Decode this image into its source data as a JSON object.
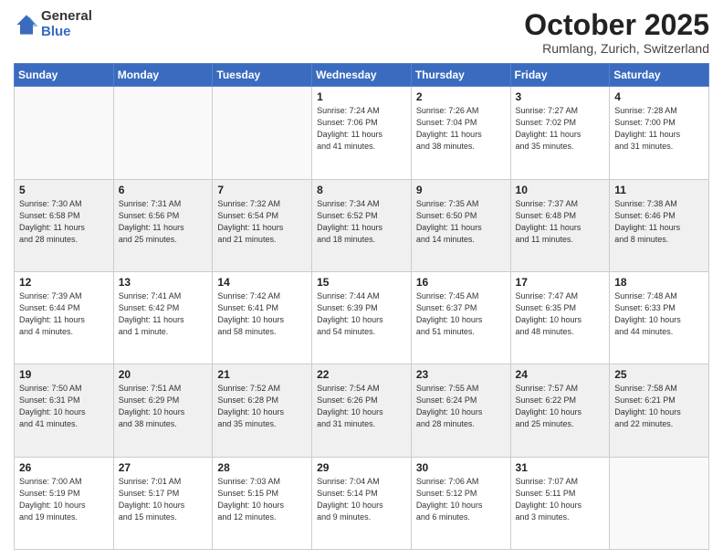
{
  "logo": {
    "general": "General",
    "blue": "Blue"
  },
  "header": {
    "month": "October 2025",
    "location": "Rumlang, Zurich, Switzerland"
  },
  "days_of_week": [
    "Sunday",
    "Monday",
    "Tuesday",
    "Wednesday",
    "Thursday",
    "Friday",
    "Saturday"
  ],
  "weeks": [
    [
      {
        "day": "",
        "info": ""
      },
      {
        "day": "",
        "info": ""
      },
      {
        "day": "",
        "info": ""
      },
      {
        "day": "1",
        "info": "Sunrise: 7:24 AM\nSunset: 7:06 PM\nDaylight: 11 hours\nand 41 minutes."
      },
      {
        "day": "2",
        "info": "Sunrise: 7:26 AM\nSunset: 7:04 PM\nDaylight: 11 hours\nand 38 minutes."
      },
      {
        "day": "3",
        "info": "Sunrise: 7:27 AM\nSunset: 7:02 PM\nDaylight: 11 hours\nand 35 minutes."
      },
      {
        "day": "4",
        "info": "Sunrise: 7:28 AM\nSunset: 7:00 PM\nDaylight: 11 hours\nand 31 minutes."
      }
    ],
    [
      {
        "day": "5",
        "info": "Sunrise: 7:30 AM\nSunset: 6:58 PM\nDaylight: 11 hours\nand 28 minutes."
      },
      {
        "day": "6",
        "info": "Sunrise: 7:31 AM\nSunset: 6:56 PM\nDaylight: 11 hours\nand 25 minutes."
      },
      {
        "day": "7",
        "info": "Sunrise: 7:32 AM\nSunset: 6:54 PM\nDaylight: 11 hours\nand 21 minutes."
      },
      {
        "day": "8",
        "info": "Sunrise: 7:34 AM\nSunset: 6:52 PM\nDaylight: 11 hours\nand 18 minutes."
      },
      {
        "day": "9",
        "info": "Sunrise: 7:35 AM\nSunset: 6:50 PM\nDaylight: 11 hours\nand 14 minutes."
      },
      {
        "day": "10",
        "info": "Sunrise: 7:37 AM\nSunset: 6:48 PM\nDaylight: 11 hours\nand 11 minutes."
      },
      {
        "day": "11",
        "info": "Sunrise: 7:38 AM\nSunset: 6:46 PM\nDaylight: 11 hours\nand 8 minutes."
      }
    ],
    [
      {
        "day": "12",
        "info": "Sunrise: 7:39 AM\nSunset: 6:44 PM\nDaylight: 11 hours\nand 4 minutes."
      },
      {
        "day": "13",
        "info": "Sunrise: 7:41 AM\nSunset: 6:42 PM\nDaylight: 11 hours\nand 1 minute."
      },
      {
        "day": "14",
        "info": "Sunrise: 7:42 AM\nSunset: 6:41 PM\nDaylight: 10 hours\nand 58 minutes."
      },
      {
        "day": "15",
        "info": "Sunrise: 7:44 AM\nSunset: 6:39 PM\nDaylight: 10 hours\nand 54 minutes."
      },
      {
        "day": "16",
        "info": "Sunrise: 7:45 AM\nSunset: 6:37 PM\nDaylight: 10 hours\nand 51 minutes."
      },
      {
        "day": "17",
        "info": "Sunrise: 7:47 AM\nSunset: 6:35 PM\nDaylight: 10 hours\nand 48 minutes."
      },
      {
        "day": "18",
        "info": "Sunrise: 7:48 AM\nSunset: 6:33 PM\nDaylight: 10 hours\nand 44 minutes."
      }
    ],
    [
      {
        "day": "19",
        "info": "Sunrise: 7:50 AM\nSunset: 6:31 PM\nDaylight: 10 hours\nand 41 minutes."
      },
      {
        "day": "20",
        "info": "Sunrise: 7:51 AM\nSunset: 6:29 PM\nDaylight: 10 hours\nand 38 minutes."
      },
      {
        "day": "21",
        "info": "Sunrise: 7:52 AM\nSunset: 6:28 PM\nDaylight: 10 hours\nand 35 minutes."
      },
      {
        "day": "22",
        "info": "Sunrise: 7:54 AM\nSunset: 6:26 PM\nDaylight: 10 hours\nand 31 minutes."
      },
      {
        "day": "23",
        "info": "Sunrise: 7:55 AM\nSunset: 6:24 PM\nDaylight: 10 hours\nand 28 minutes."
      },
      {
        "day": "24",
        "info": "Sunrise: 7:57 AM\nSunset: 6:22 PM\nDaylight: 10 hours\nand 25 minutes."
      },
      {
        "day": "25",
        "info": "Sunrise: 7:58 AM\nSunset: 6:21 PM\nDaylight: 10 hours\nand 22 minutes."
      }
    ],
    [
      {
        "day": "26",
        "info": "Sunrise: 7:00 AM\nSunset: 5:19 PM\nDaylight: 10 hours\nand 19 minutes."
      },
      {
        "day": "27",
        "info": "Sunrise: 7:01 AM\nSunset: 5:17 PM\nDaylight: 10 hours\nand 15 minutes."
      },
      {
        "day": "28",
        "info": "Sunrise: 7:03 AM\nSunset: 5:15 PM\nDaylight: 10 hours\nand 12 minutes."
      },
      {
        "day": "29",
        "info": "Sunrise: 7:04 AM\nSunset: 5:14 PM\nDaylight: 10 hours\nand 9 minutes."
      },
      {
        "day": "30",
        "info": "Sunrise: 7:06 AM\nSunset: 5:12 PM\nDaylight: 10 hours\nand 6 minutes."
      },
      {
        "day": "31",
        "info": "Sunrise: 7:07 AM\nSunset: 5:11 PM\nDaylight: 10 hours\nand 3 minutes."
      },
      {
        "day": "",
        "info": ""
      }
    ]
  ]
}
